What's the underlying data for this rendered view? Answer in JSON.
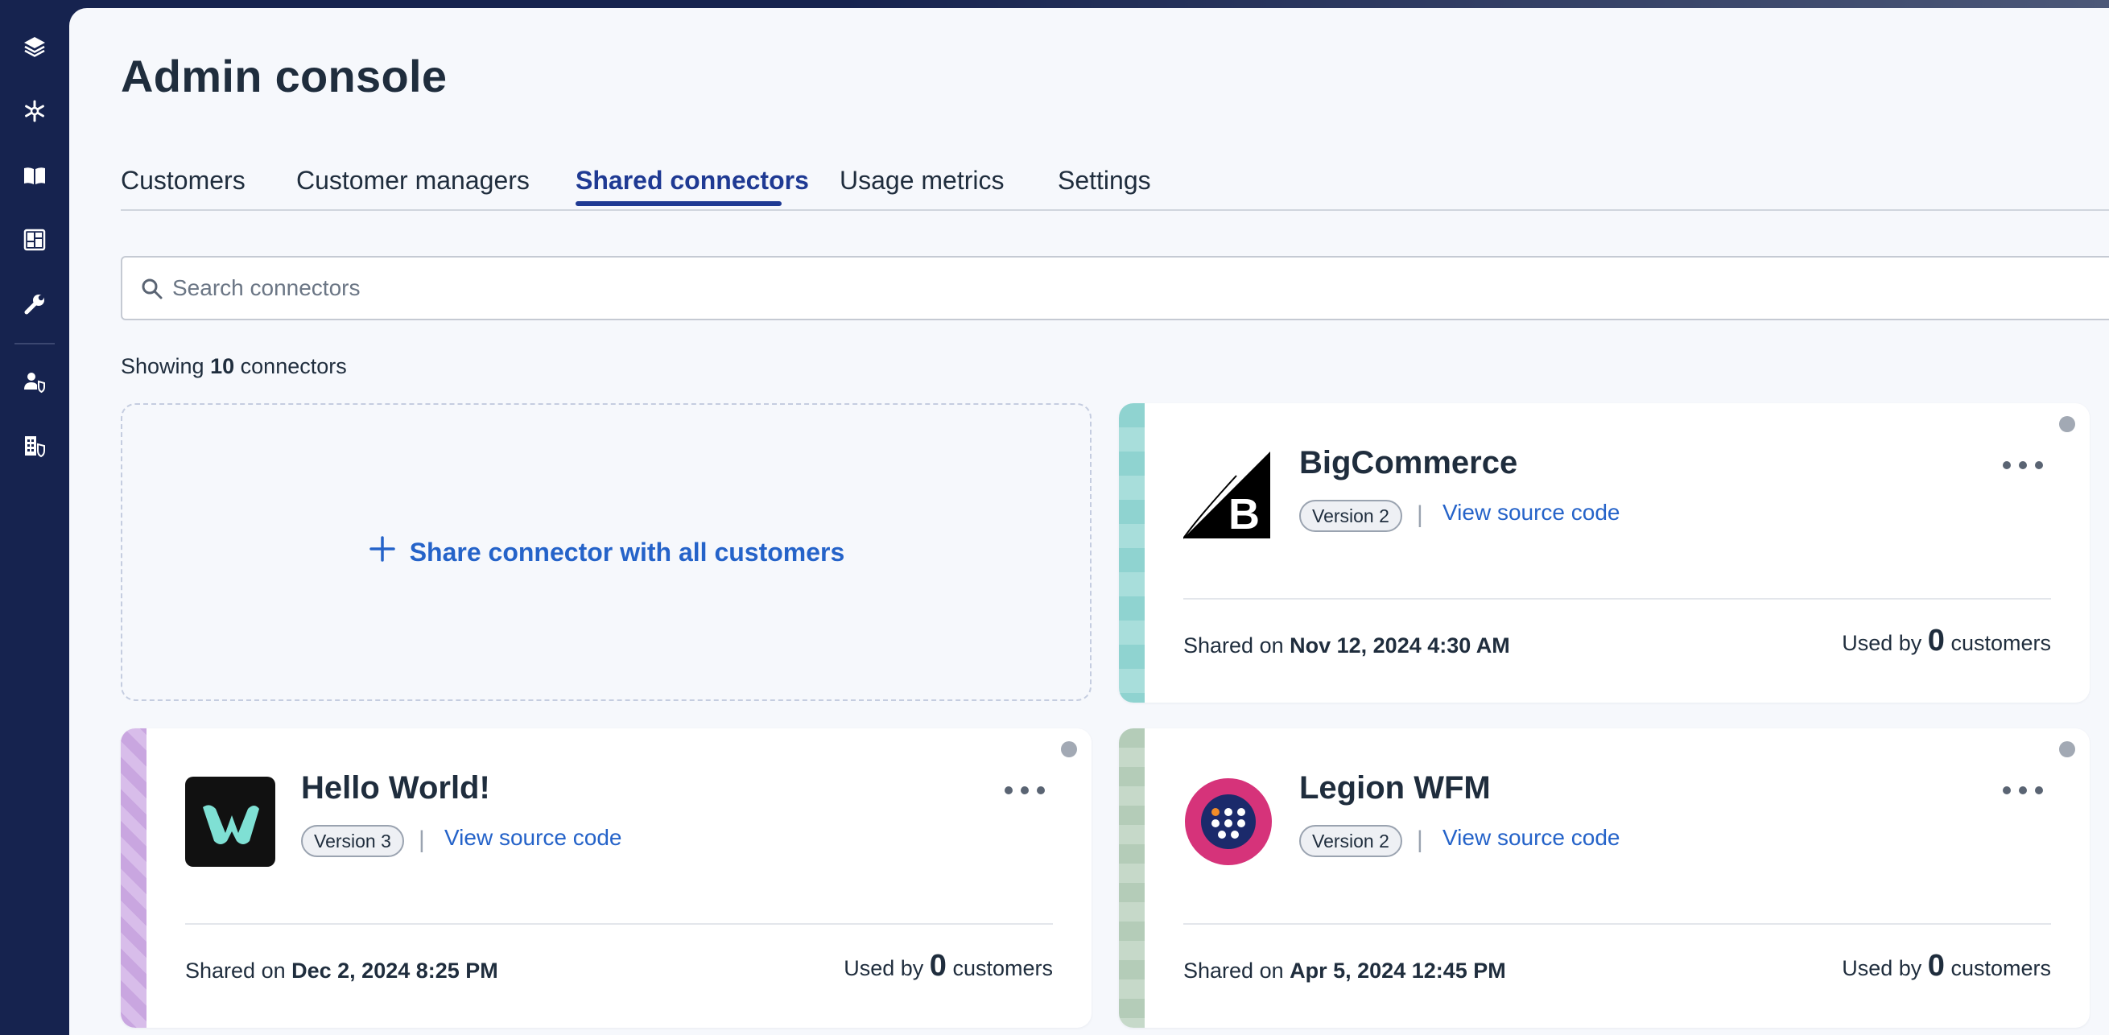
{
  "page": {
    "title": "Admin console"
  },
  "tabs": [
    {
      "label": "Customers",
      "active": false
    },
    {
      "label": "Customer managers",
      "active": false
    },
    {
      "label": "Shared connectors",
      "active": true
    },
    {
      "label": "Usage metrics",
      "active": false
    },
    {
      "label": "Settings",
      "active": false
    }
  ],
  "sidebar": {
    "icons": [
      "layers-icon",
      "snowflake-icon",
      "book-icon",
      "dashboard-icon",
      "wrench-icon",
      "user-shield-icon",
      "building-shield-icon"
    ]
  },
  "search": {
    "placeholder": "Search connectors"
  },
  "summary": {
    "prefix": "Showing",
    "count": "10",
    "suffix": "connectors"
  },
  "share_box": {
    "label": "Share connector with all customers"
  },
  "colors": {
    "accent": "#2563c9",
    "nav_bg": "#16234f",
    "tab_active": "#1f3a93"
  },
  "connectors": [
    {
      "name": "BigCommerce",
      "version": "Version 2",
      "source_link": "View source code",
      "shared_prefix": "Shared on",
      "shared_date": "Nov 12, 2024 4:30 AM",
      "used_prefix": "Used by",
      "used_count": "0",
      "used_suffix": "customers",
      "logo": "bigcommerce-logo",
      "stripe_color": "#8fd3d0"
    },
    {
      "name": "Hello World!",
      "version": "Version 3",
      "source_link": "View source code",
      "shared_prefix": "Shared on",
      "shared_date": "Dec 2, 2024 8:25 PM",
      "used_prefix": "Used by",
      "used_count": "0",
      "used_suffix": "customers",
      "logo": "hello-world-logo",
      "stripe_color": "#c9a6e0"
    },
    {
      "name": "Legion WFM",
      "version": "Version 2",
      "source_link": "View source code",
      "shared_prefix": "Shared on",
      "shared_date": "Apr 5, 2024 12:45 PM",
      "used_prefix": "Used by",
      "used_count": "0",
      "used_suffix": "customers",
      "logo": "legion-wfm-logo",
      "stripe_color": "#b4ccb8"
    }
  ]
}
